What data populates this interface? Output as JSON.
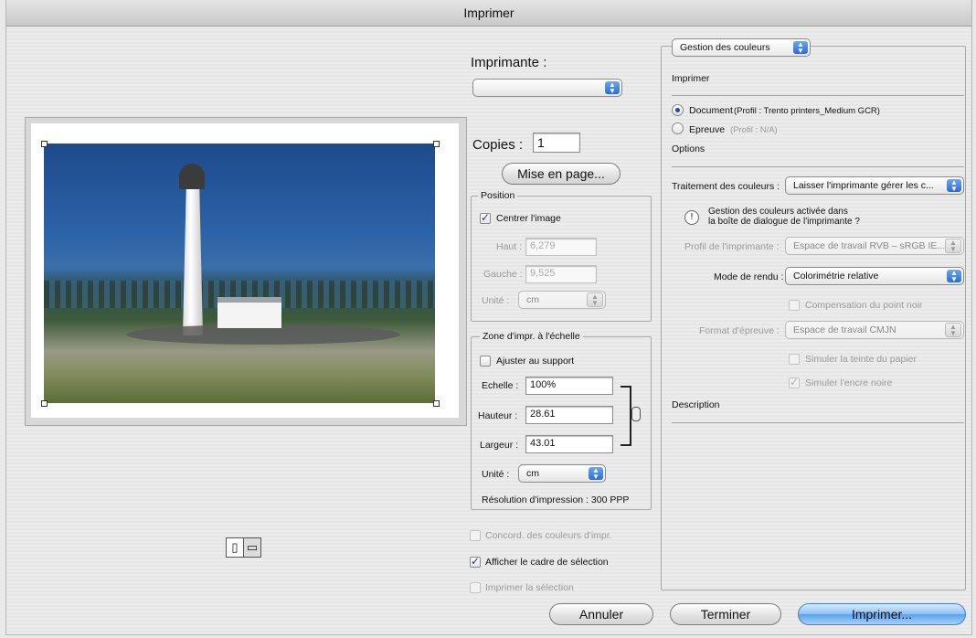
{
  "window": {
    "title": "Imprimer"
  },
  "printer": {
    "label": "Imprimante :",
    "value": ""
  },
  "copies": {
    "label": "Copies :",
    "value": "1"
  },
  "page_setup_button": "Mise en page...",
  "position": {
    "title": "Position",
    "center_label": "Centrer l'image",
    "center_checked": true,
    "top_label": "Haut :",
    "top_value": "6,279",
    "left_label": "Gauche :",
    "left_value": "9,525",
    "unit_label": "Unité :",
    "unit_value": "cm"
  },
  "scale": {
    "title": "Zone d'impr. à l'échelle",
    "fit_label": "Ajuster au support",
    "fit_checked": false,
    "scale_label": "Echelle :",
    "scale_value": "100%",
    "height_label": "Hauteur :",
    "height_value": "28.61",
    "width_label": "Largeur :",
    "width_value": "43.01",
    "unit_label": "Unité :",
    "unit_value": "cm",
    "resolution": "Résolution d'impression : 300 PPP"
  },
  "options": {
    "match_colors": "Concord. des couleurs d'impr.",
    "show_bbox": "Afficher le cadre de sélection",
    "print_selection": "Imprimer la sélection"
  },
  "right": {
    "mode_popup": "Gestion des couleurs",
    "print_header": "Imprimer",
    "document_label": "Document",
    "document_profile": "(Profil : Trento printers_Medium GCR)",
    "proof_label": "Epreuve",
    "proof_profile": "(Profil : N/A)",
    "options_header": "Options",
    "color_handling_label": "Traitement des couleurs :",
    "color_handling_value": "Laisser l'imprimante gérer les c...",
    "warning_line1": "Gestion des couleurs activée dans",
    "warning_line2": "la boîte de dialogue de l'imprimante ?",
    "printer_profile_label": "Profil de l'imprimante :",
    "printer_profile_value": "Espace de travail RVB – sRGB IE...",
    "rendering_label": "Mode de rendu :",
    "rendering_value": "Colorimétrie relative",
    "black_point": "Compensation du point noir",
    "proof_setup_label": "Format d'épreuve :",
    "proof_setup_value": "Espace de travail CMJN",
    "simulate_paper": "Simuler la teinte du papier",
    "simulate_ink": "Simuler l'encre noire",
    "description_header": "Description"
  },
  "buttons": {
    "cancel": "Annuler",
    "done": "Terminer",
    "print": "Imprimer..."
  },
  "icons": {
    "check": "✓",
    "popup_arrows": "▲▼",
    "warning": "!"
  }
}
